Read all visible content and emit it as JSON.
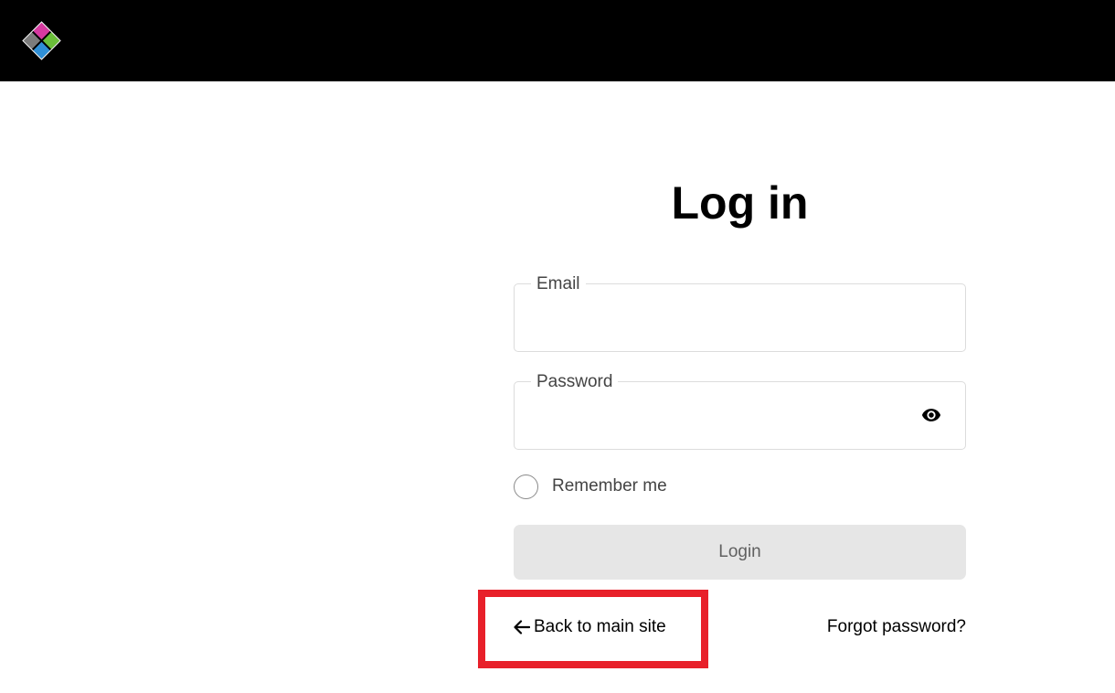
{
  "header": {
    "logo_icon": "diamond-logo-icon",
    "logo_colors": [
      "#d63aa0",
      "#7c7c7c",
      "#6bbf3a",
      "#2f8fd6"
    ]
  },
  "login": {
    "title": "Log in",
    "email": {
      "label": "Email",
      "value": "",
      "placeholder": ""
    },
    "password": {
      "label": "Password",
      "value": "",
      "placeholder": "",
      "toggle_icon": "eye-icon"
    },
    "remember_me": {
      "label": "Remember me",
      "checked": false
    },
    "submit_label": "Login",
    "back_link_label": "Back to main site",
    "back_link_icon": "arrow-left-icon",
    "forgot_link_label": "Forgot password?"
  },
  "annotation": {
    "highlight_color": "#e8202a"
  }
}
